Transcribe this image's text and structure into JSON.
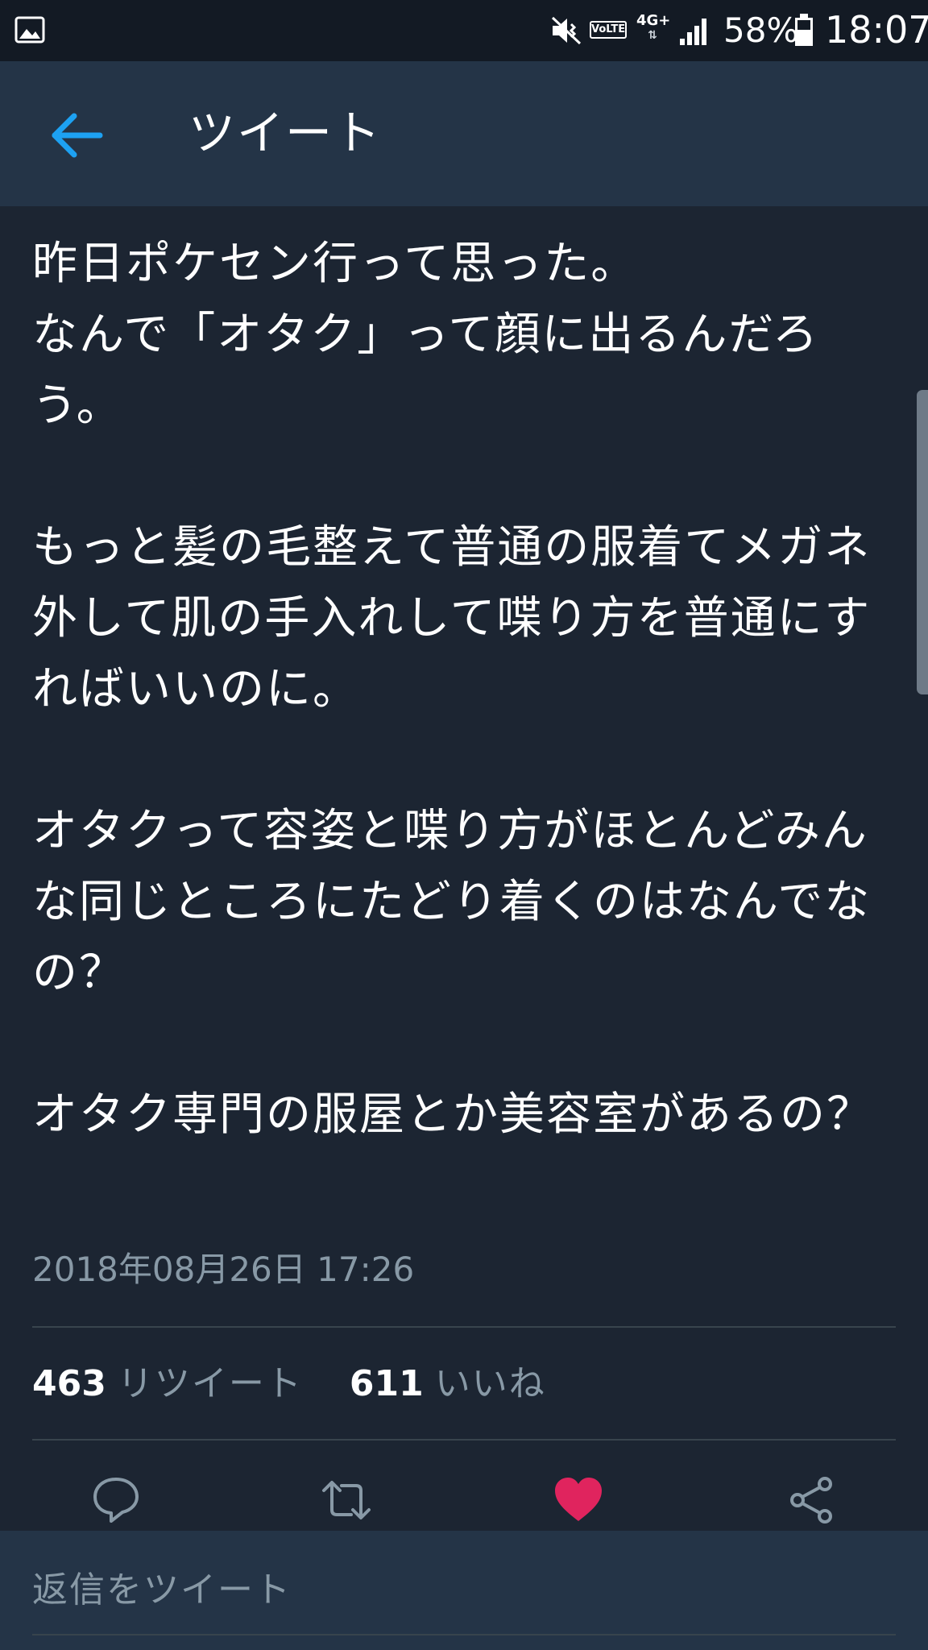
{
  "status_bar": {
    "volte_label": "VoLTE",
    "network_label": "4G+",
    "network_arrows": "⇅",
    "battery_percent": "58%",
    "time": "18:07",
    "icons": [
      "gallery-icon",
      "mute-icon",
      "signal-icon",
      "battery-icon"
    ]
  },
  "header": {
    "title": "ツイート",
    "back_icon": "arrow-left-icon"
  },
  "tweet": {
    "paragraphs": [
      "昨日ポケセン行って思った。\nなんで「オタク」って顔に出るんだろう。",
      "もっと髪の毛整えて普通の服着てメガネ外して肌の手入れして喋り方を普通にすればいいのに。",
      "オタクって容姿と喋り方がほとんどみんな同じところにたどり着くのはなんでなの？",
      "オタク専門の服屋とか美容室があるの？"
    ],
    "timestamp": "2018年08月26日 17:26",
    "retweet_count": "463",
    "retweet_label": "リツイート",
    "like_count": "611",
    "like_label": "いいね"
  },
  "actions": {
    "reply_icon": "reply-icon",
    "retweet_icon": "retweet-icon",
    "like_icon": "heart-icon",
    "share_icon": "share-icon",
    "liked": true
  },
  "reply_bar": {
    "placeholder": "返信をツイート"
  },
  "colors": {
    "background": "#1c2532",
    "header": "#243447",
    "accent_blue": "#1da1f2",
    "like_red": "#e0245e",
    "muted_text": "#8899a6"
  }
}
